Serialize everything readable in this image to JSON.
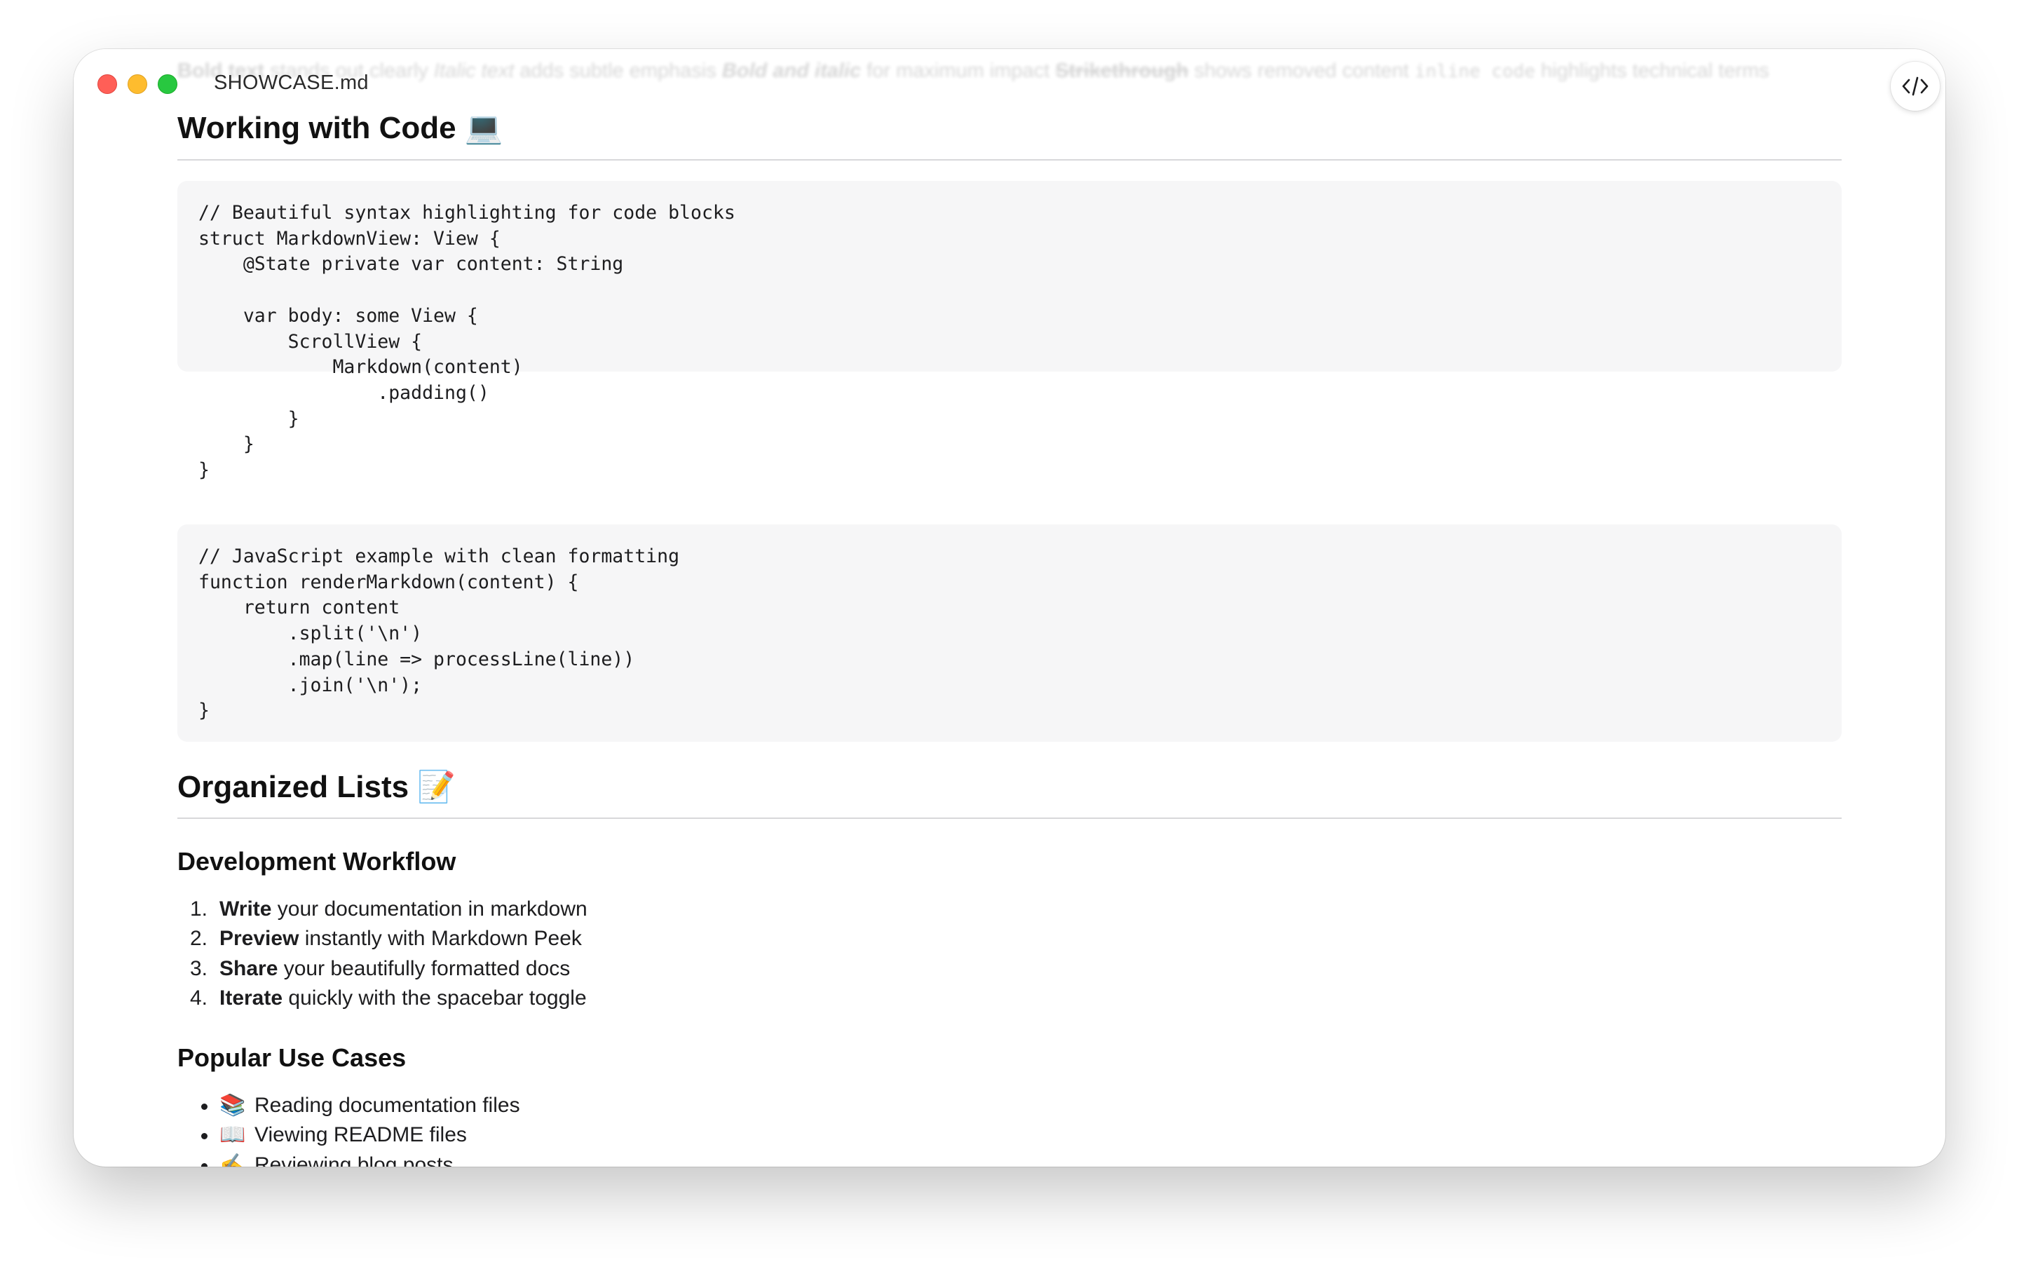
{
  "window": {
    "title": "SHOWCASE.md",
    "source_toggle_icon": "code-brackets-icon"
  },
  "scrolled_line": {
    "bold": "Bold text",
    "after_bold": " stands out clearly ",
    "italic": "Italic text",
    "after_italic": " adds subtle emphasis ",
    "bold_italic": "Bold and italic",
    "after_bold_italic": " for maximum impact ",
    "strike": "Strikethrough",
    "after_strike": " shows removed content ",
    "inline_code": "inline code",
    "after_code": " highlights technical terms"
  },
  "sections": {
    "code": {
      "heading": "Working with Code",
      "emoji": "💻",
      "block1": "// Beautiful syntax highlighting for code blocks\nstruct MarkdownView: View {\n    @State private var content: String\n\n    var body: some View {\n        ScrollView {\n            Markdown(content)\n                .padding()\n        }\n    }\n}",
      "block2": "// JavaScript example with clean formatting\nfunction renderMarkdown(content) {\n    return content\n        .split('\\n')\n        .map(line => processLine(line))\n        .join('\\n');\n}"
    },
    "lists": {
      "heading": "Organized Lists",
      "emoji": "📝",
      "workflow": {
        "heading": "Development Workflow",
        "items": [
          {
            "num": "1.",
            "bold": "Write",
            "rest": " your documentation in markdown"
          },
          {
            "num": "2.",
            "bold": "Preview",
            "rest": " instantly with Markdown Peek"
          },
          {
            "num": "3.",
            "bold": "Share",
            "rest": " your beautifully formatted docs"
          },
          {
            "num": "4.",
            "bold": "Iterate",
            "rest": " quickly with the spacebar toggle"
          }
        ]
      },
      "use_cases": {
        "heading": "Popular Use Cases",
        "items": [
          {
            "icon": "📚",
            "text": "Reading documentation files"
          },
          {
            "icon": "📖",
            "text": "Viewing README files"
          },
          {
            "icon": "✍️",
            "text": "Reviewing blog posts"
          }
        ]
      }
    }
  }
}
